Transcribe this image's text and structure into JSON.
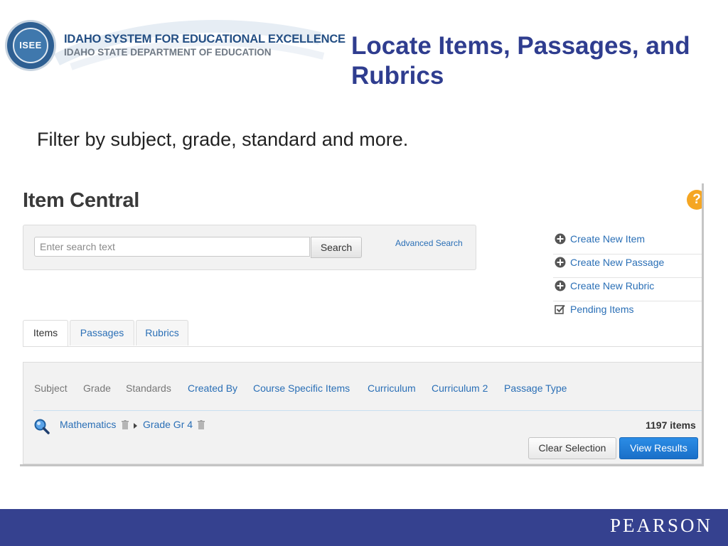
{
  "logo": {
    "seal_text": "ISEE",
    "line1": "IDAHO SYSTEM FOR EDUCATIONAL EXCELLENCE",
    "line2": "IDAHO STATE DEPARTMENT OF EDUCATION"
  },
  "slide": {
    "title": "Locate Items, Passages, and Rubrics",
    "subtitle": "Filter by subject, grade, standard and more."
  },
  "app": {
    "title": "Item Central",
    "help_icon": "question-icon",
    "search": {
      "placeholder": "Enter search text",
      "value": "",
      "button_label": "Search",
      "advanced_link": "Advanced Search"
    },
    "side_actions": [
      {
        "label": "Create New Item",
        "icon": "plus-circle-icon"
      },
      {
        "label": "Create New Passage",
        "icon": "plus-circle-icon"
      },
      {
        "label": "Create New Rubric",
        "icon": "plus-circle-icon"
      },
      {
        "label": "Pending Items",
        "icon": "checkbox-icon"
      }
    ],
    "tabs": [
      {
        "label": "Items",
        "active": true
      },
      {
        "label": "Passages",
        "active": false
      },
      {
        "label": "Rubrics",
        "active": false
      }
    ],
    "filter_categories": [
      {
        "label": "Subject"
      },
      {
        "label": "Grade"
      },
      {
        "label": "Standards"
      },
      {
        "label": "Created By"
      },
      {
        "label": "Course Specific Items"
      },
      {
        "label": "Curriculum"
      },
      {
        "label": "Curriculum 2"
      },
      {
        "label": "Passage Type"
      }
    ],
    "selection": {
      "subject": "Mathematics",
      "grade": "Grade Gr 4"
    },
    "result_count": "1197 items",
    "clear_button": "Clear Selection",
    "view_button": "View Results"
  },
  "footer": {
    "brand": "PEARSON",
    "color": "#35418f"
  }
}
